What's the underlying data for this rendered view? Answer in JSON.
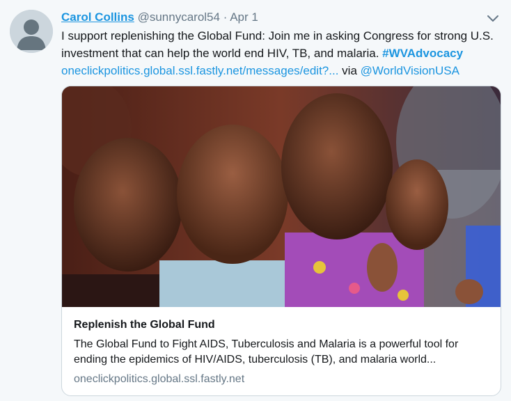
{
  "tweet": {
    "author_name": "Carol Collins",
    "handle": "@sunnycarol54",
    "separator": "·",
    "date": "Apr 1",
    "text": "I support replenishing the Global Fund: Join me in asking Congress for strong U.S. investment that can help the world end HIV, TB, and malaria. ",
    "hashtag": "#WVAdvocacy",
    "link": "oneclickpolitics.global.ssl.fastly.net/messages/edit?...",
    "via_label": " via ",
    "via_handle": "@WorldVisionUSA"
  },
  "card": {
    "title": "Replenish the Global Fund",
    "description": "The Global Fund to Fight AIDS, Tuberculosis and Malaria is a powerful tool for ending the epidemics of HIV/AIDS, tuberculosis (TB), and malaria world...",
    "domain": "oneclickpolitics.global.ssl.fastly.net"
  },
  "icons": {
    "avatar": "default-user-icon",
    "menu": "chevron-down-icon"
  },
  "colors": {
    "link": "#1b95e0",
    "secondary_text": "#657786",
    "background": "#f5f8fa"
  }
}
